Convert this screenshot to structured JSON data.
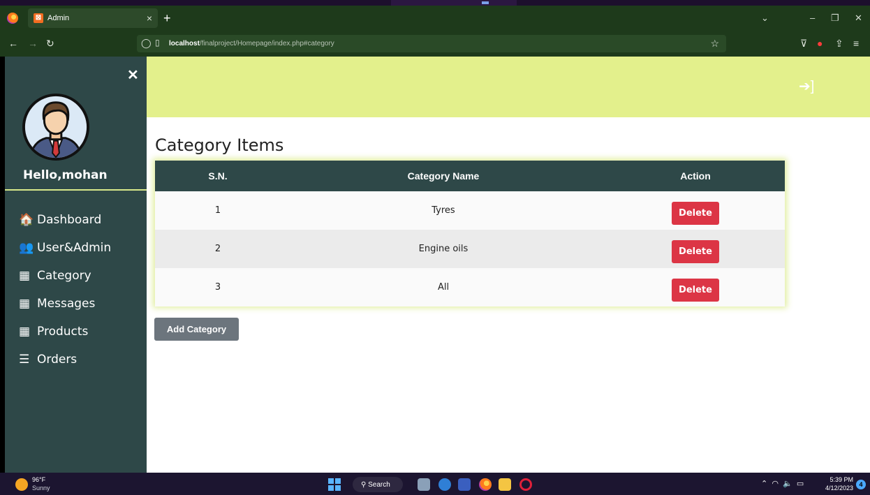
{
  "browser": {
    "tab_title": "Admin",
    "tab_favicon": "xampp-icon",
    "tab_close": "×",
    "new_tab": "+",
    "url_host": "localhost",
    "url_path": "/finalproject/Homepage/index.php#category",
    "window_controls": {
      "dropdown": "⌄",
      "minimize": "–",
      "restore": "❐",
      "close": "✕"
    }
  },
  "sidebar": {
    "close": "✕",
    "greeting": "Hello,mohan",
    "items": [
      {
        "icon": "home-icon",
        "glyph": "🏠",
        "label": "Dashboard"
      },
      {
        "icon": "users-icon",
        "glyph": "👥",
        "label": "User&Admin"
      },
      {
        "icon": "grid-icon",
        "glyph": "▦",
        "label": "Category"
      },
      {
        "icon": "grid-icon",
        "glyph": "▦",
        "label": "Messages"
      },
      {
        "icon": "grid-icon",
        "glyph": "▦",
        "label": "Products"
      },
      {
        "icon": "list-icon",
        "glyph": "☰",
        "label": "Orders"
      }
    ]
  },
  "main": {
    "title": "Category Items",
    "table": {
      "headers": [
        "S.N.",
        "Category Name",
        "Action"
      ],
      "rows": [
        {
          "sn": "1",
          "name": "Tyres",
          "action": "Delete"
        },
        {
          "sn": "2",
          "name": "Engine oils",
          "action": "Delete"
        },
        {
          "sn": "3",
          "name": "All",
          "action": "Delete"
        }
      ]
    },
    "add_button": "Add Category"
  },
  "taskbar": {
    "weather_temp": "96°F",
    "weather_desc": "Sunny",
    "search": "Search",
    "time": "5:39 PM",
    "date": "4/12/2023",
    "notifications": "4"
  },
  "colors": {
    "sidebar": "#2e4848",
    "banner": "#e3f08c",
    "delete": "#dc3545",
    "add": "#6c757d",
    "browser_chrome": "#1e3a1b"
  }
}
